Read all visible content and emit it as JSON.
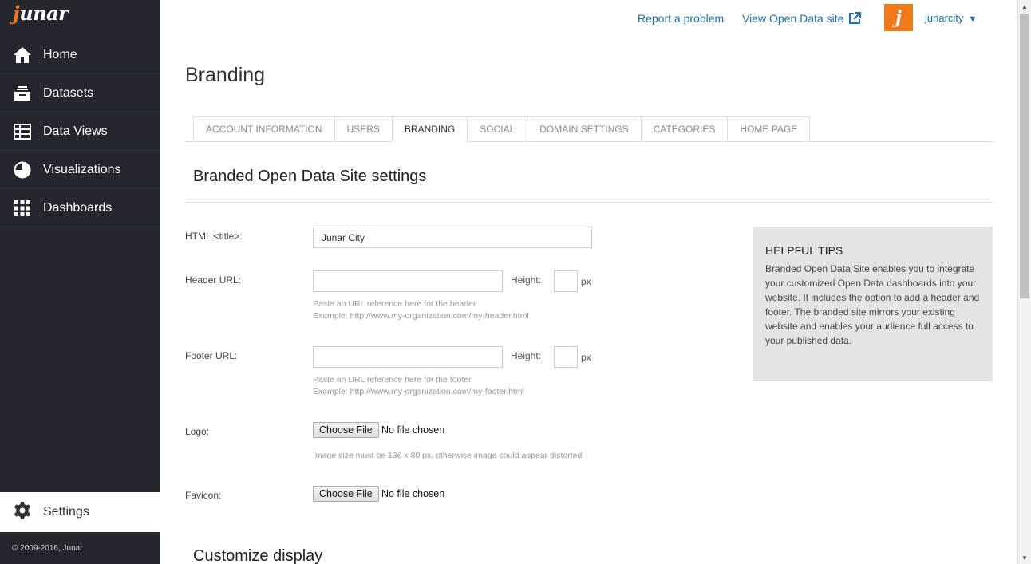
{
  "brand": {
    "logo_text": "unar",
    "logo_letter": "j",
    "accent": "#f07a1a",
    "sidebar_bg": "#24272d",
    "link_color": "#1e6fb8"
  },
  "sidebar": {
    "items": [
      {
        "label": "Home",
        "icon": "home-icon"
      },
      {
        "label": "Datasets",
        "icon": "inbox-tray-icon"
      },
      {
        "label": "Data Views",
        "icon": "table-icon"
      },
      {
        "label": "Visualizations",
        "icon": "pie-chart-icon"
      },
      {
        "label": "Dashboards",
        "icon": "grid-icon"
      }
    ],
    "settings_label": "Settings",
    "copyright": "© 2009-2016, Junar"
  },
  "topbar": {
    "report_label": "Report a problem",
    "view_site_label": "View Open Data site",
    "avatar_letter": "j",
    "username": "junarcity",
    "caret": "▼"
  },
  "page": {
    "title": "Branding"
  },
  "tabs": [
    {
      "label": "ACCOUNT INFORMATION",
      "active": false
    },
    {
      "label": "USERS",
      "active": false
    },
    {
      "label": "BRANDING",
      "active": true
    },
    {
      "label": "SOCIAL",
      "active": false
    },
    {
      "label": "DOMAIN SETTINGS",
      "active": false
    },
    {
      "label": "CATEGORIES",
      "active": false
    },
    {
      "label": "HOME PAGE",
      "active": false
    }
  ],
  "form": {
    "section_title": "Branded Open Data Site settings",
    "html_title": {
      "label": "HTML <title>:",
      "value": "Junar City"
    },
    "header": {
      "label": "Header URL:",
      "value": "",
      "height_label": "Height:",
      "height_value": "",
      "unit": "px",
      "hint_1": "Paste an URL reference here for the header",
      "hint_2": "Example: http://www.my-organization.com/my-header.html"
    },
    "footer": {
      "label": "Footer URL:",
      "value": "",
      "height_label": "Height:",
      "height_value": "",
      "unit": "px",
      "hint_1": "Paste an URL reference here for the footer",
      "hint_2": "Example: http://www.my-organization.com/my-footer.html"
    },
    "logo": {
      "label": "Logo:",
      "button": "Choose File",
      "status": "No file chosen",
      "hint": "Image size must be 136 x 80 px, otherwise image could appear distorted"
    },
    "favicon": {
      "label": "Favicon:",
      "button": "Choose File",
      "status": "No file chosen"
    }
  },
  "tips": {
    "title": "HELPFUL TIPS",
    "body": "Branded Open Data Site enables you to integrate your customized Open Data dashboards into your website. It includes the option to add a header and footer. The branded site mirrors your existing website and enables your audience full access to your published data."
  },
  "section2": {
    "title": "Customize display"
  }
}
